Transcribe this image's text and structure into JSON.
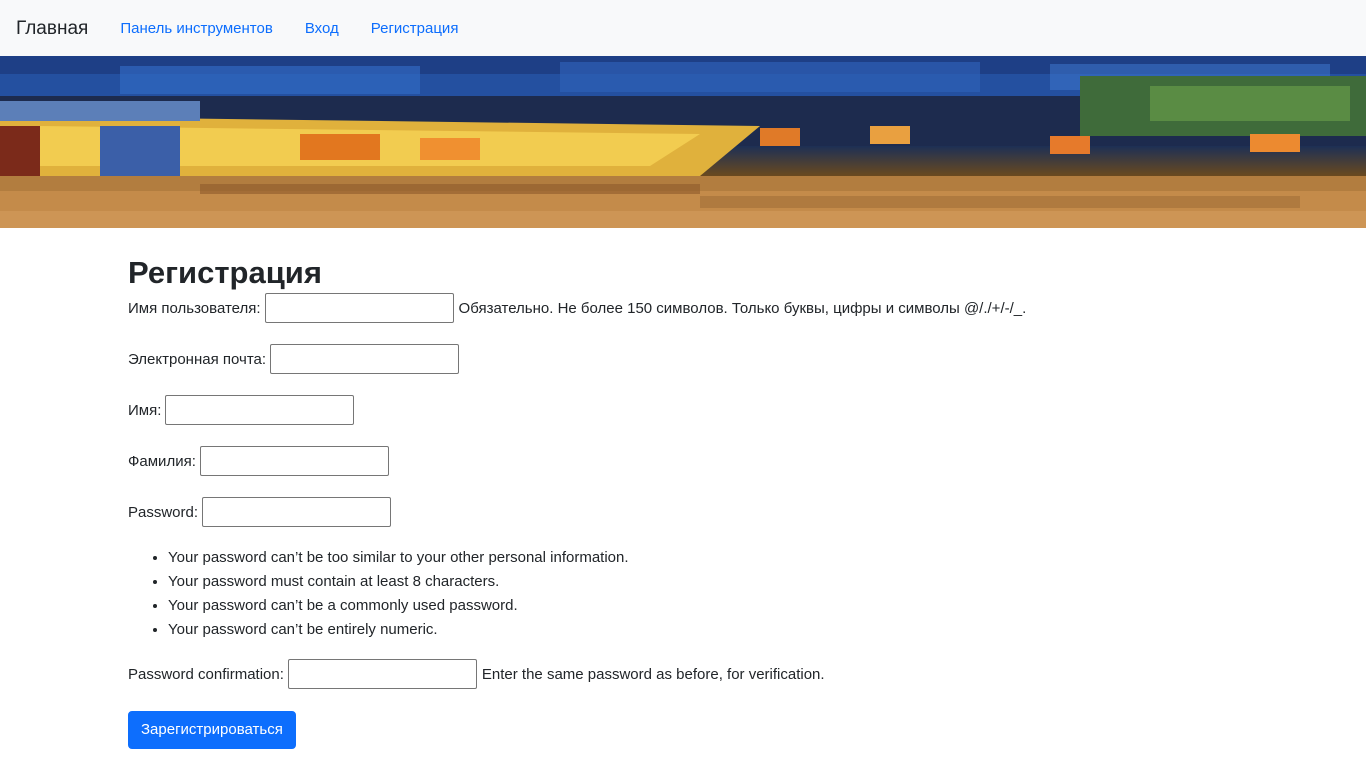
{
  "navbar": {
    "brand": "Главная",
    "links": [
      "Панель инструментов",
      "Вход",
      "Регистрация"
    ]
  },
  "page": {
    "title": "Регистрация"
  },
  "form": {
    "username": {
      "label": "Имя пользователя:",
      "value": "",
      "help": "Обязательно. Не более 150 символов. Только буквы, цифры и символы @/./+/-/_."
    },
    "email": {
      "label": "Электронная почта:",
      "value": ""
    },
    "first_name": {
      "label": "Имя:",
      "value": ""
    },
    "last_name": {
      "label": "Фамилия:",
      "value": ""
    },
    "password": {
      "label": "Password:",
      "value": "",
      "rules": [
        "Your password can’t be too similar to your other personal information.",
        "Your password must contain at least 8 characters.",
        "Your password can’t be a commonly used password.",
        "Your password can’t be entirely numeric."
      ]
    },
    "password_confirm": {
      "label": "Password confirmation:",
      "value": "",
      "help": "Enter the same password as before, for verification."
    },
    "submit_label": "Зарегистрироваться"
  },
  "colors": {
    "link": "#0d6efd",
    "button": "#0d6efd",
    "navbar_bg": "#f8f9fa"
  }
}
